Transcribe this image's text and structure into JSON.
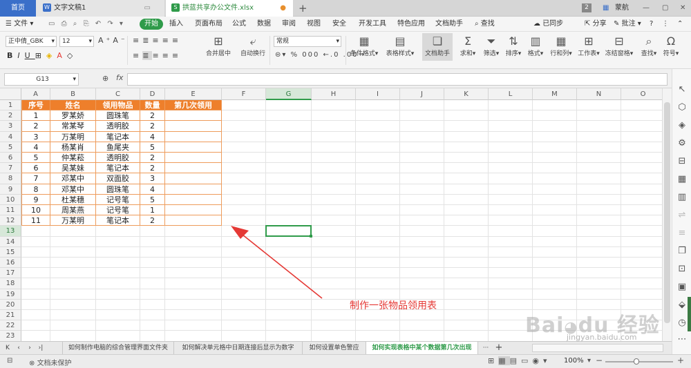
{
  "tabs": {
    "home": "首页",
    "doc": "文字文稿1",
    "xls": "拱蓝共享办公文件.xlsx",
    "page_num": "2",
    "user": "蒙航"
  },
  "menu": {
    "file": "文件",
    "start": "开始",
    "items": [
      "插入",
      "页面布局",
      "公式",
      "数据",
      "审阅",
      "视图",
      "安全",
      "开发工具",
      "特色应用",
      "文档助手"
    ],
    "search": "查找",
    "sync": "已同步",
    "share": "分享",
    "comment": "批注"
  },
  "ribbon": {
    "font": "正中倩_GBK",
    "size": "12",
    "number_format": "常规",
    "merge": "合并居中",
    "wrap": "自动换行",
    "cond": "条件格式",
    "table_style": "表格样式",
    "doc_helper": "文档助手",
    "sum": "求和",
    "filter": "筛选",
    "sort": "排序",
    "format": "格式",
    "rowcol": "行和列",
    "sheet": "工作表",
    "freeze": "冻结窗格",
    "find": "查找",
    "symbol": "符号",
    "pct": "%",
    "thousand": "000"
  },
  "formula": {
    "name_box": "G13",
    "fx": "fx"
  },
  "columns": [
    "A",
    "B",
    "C",
    "D",
    "E",
    "F",
    "G",
    "H",
    "I",
    "J",
    "K",
    "L",
    "M",
    "N",
    "O"
  ],
  "rows": [
    "1",
    "2",
    "3",
    "4",
    "5",
    "6",
    "7",
    "8",
    "9",
    "10",
    "11",
    "12",
    "13",
    "14",
    "15",
    "16",
    "17",
    "18",
    "19",
    "20",
    "21",
    "22",
    "23"
  ],
  "table": {
    "headers": [
      "序号",
      "姓名",
      "领用物品",
      "数量",
      "第几次领用"
    ],
    "rows": [
      [
        "1",
        "罗某娇",
        "圆珠笔",
        "2",
        ""
      ],
      [
        "2",
        "常某琴",
        "透明胶",
        "2",
        ""
      ],
      [
        "3",
        "万某明",
        "笔记本",
        "4",
        ""
      ],
      [
        "4",
        "杨某肖",
        "鱼尾夹",
        "5",
        ""
      ],
      [
        "5",
        "仲某菘",
        "透明胶",
        "2",
        ""
      ],
      [
        "6",
        "吴某妹",
        "笔记本",
        "2",
        ""
      ],
      [
        "7",
        "邓某中",
        "双面胶",
        "3",
        ""
      ],
      [
        "8",
        "邓某中",
        "圆珠笔",
        "4",
        ""
      ],
      [
        "9",
        "杜某穗",
        "记号笔",
        "5",
        ""
      ],
      [
        "10",
        "周某燕",
        "记号笔",
        "1",
        ""
      ],
      [
        "11",
        "万某明",
        "笔记本",
        "2",
        ""
      ]
    ]
  },
  "annotation": "制作一张物品领用表",
  "watermark": "Bai du 经验 jingyan.baidu.com",
  "sheets": [
    "如何制作电脑的综合管理界面文件夹",
    "如何解决单元格中日期连接后显示为数字",
    "如何设置单色警应",
    "如何实现表格中某个数据第几次出现"
  ],
  "status": {
    "protect": "文档未保护",
    "zoom": "100%"
  },
  "colors": {
    "accent": "#2f9b4a",
    "header_fill": "#ee7f2b",
    "arrow": "#e53935"
  }
}
